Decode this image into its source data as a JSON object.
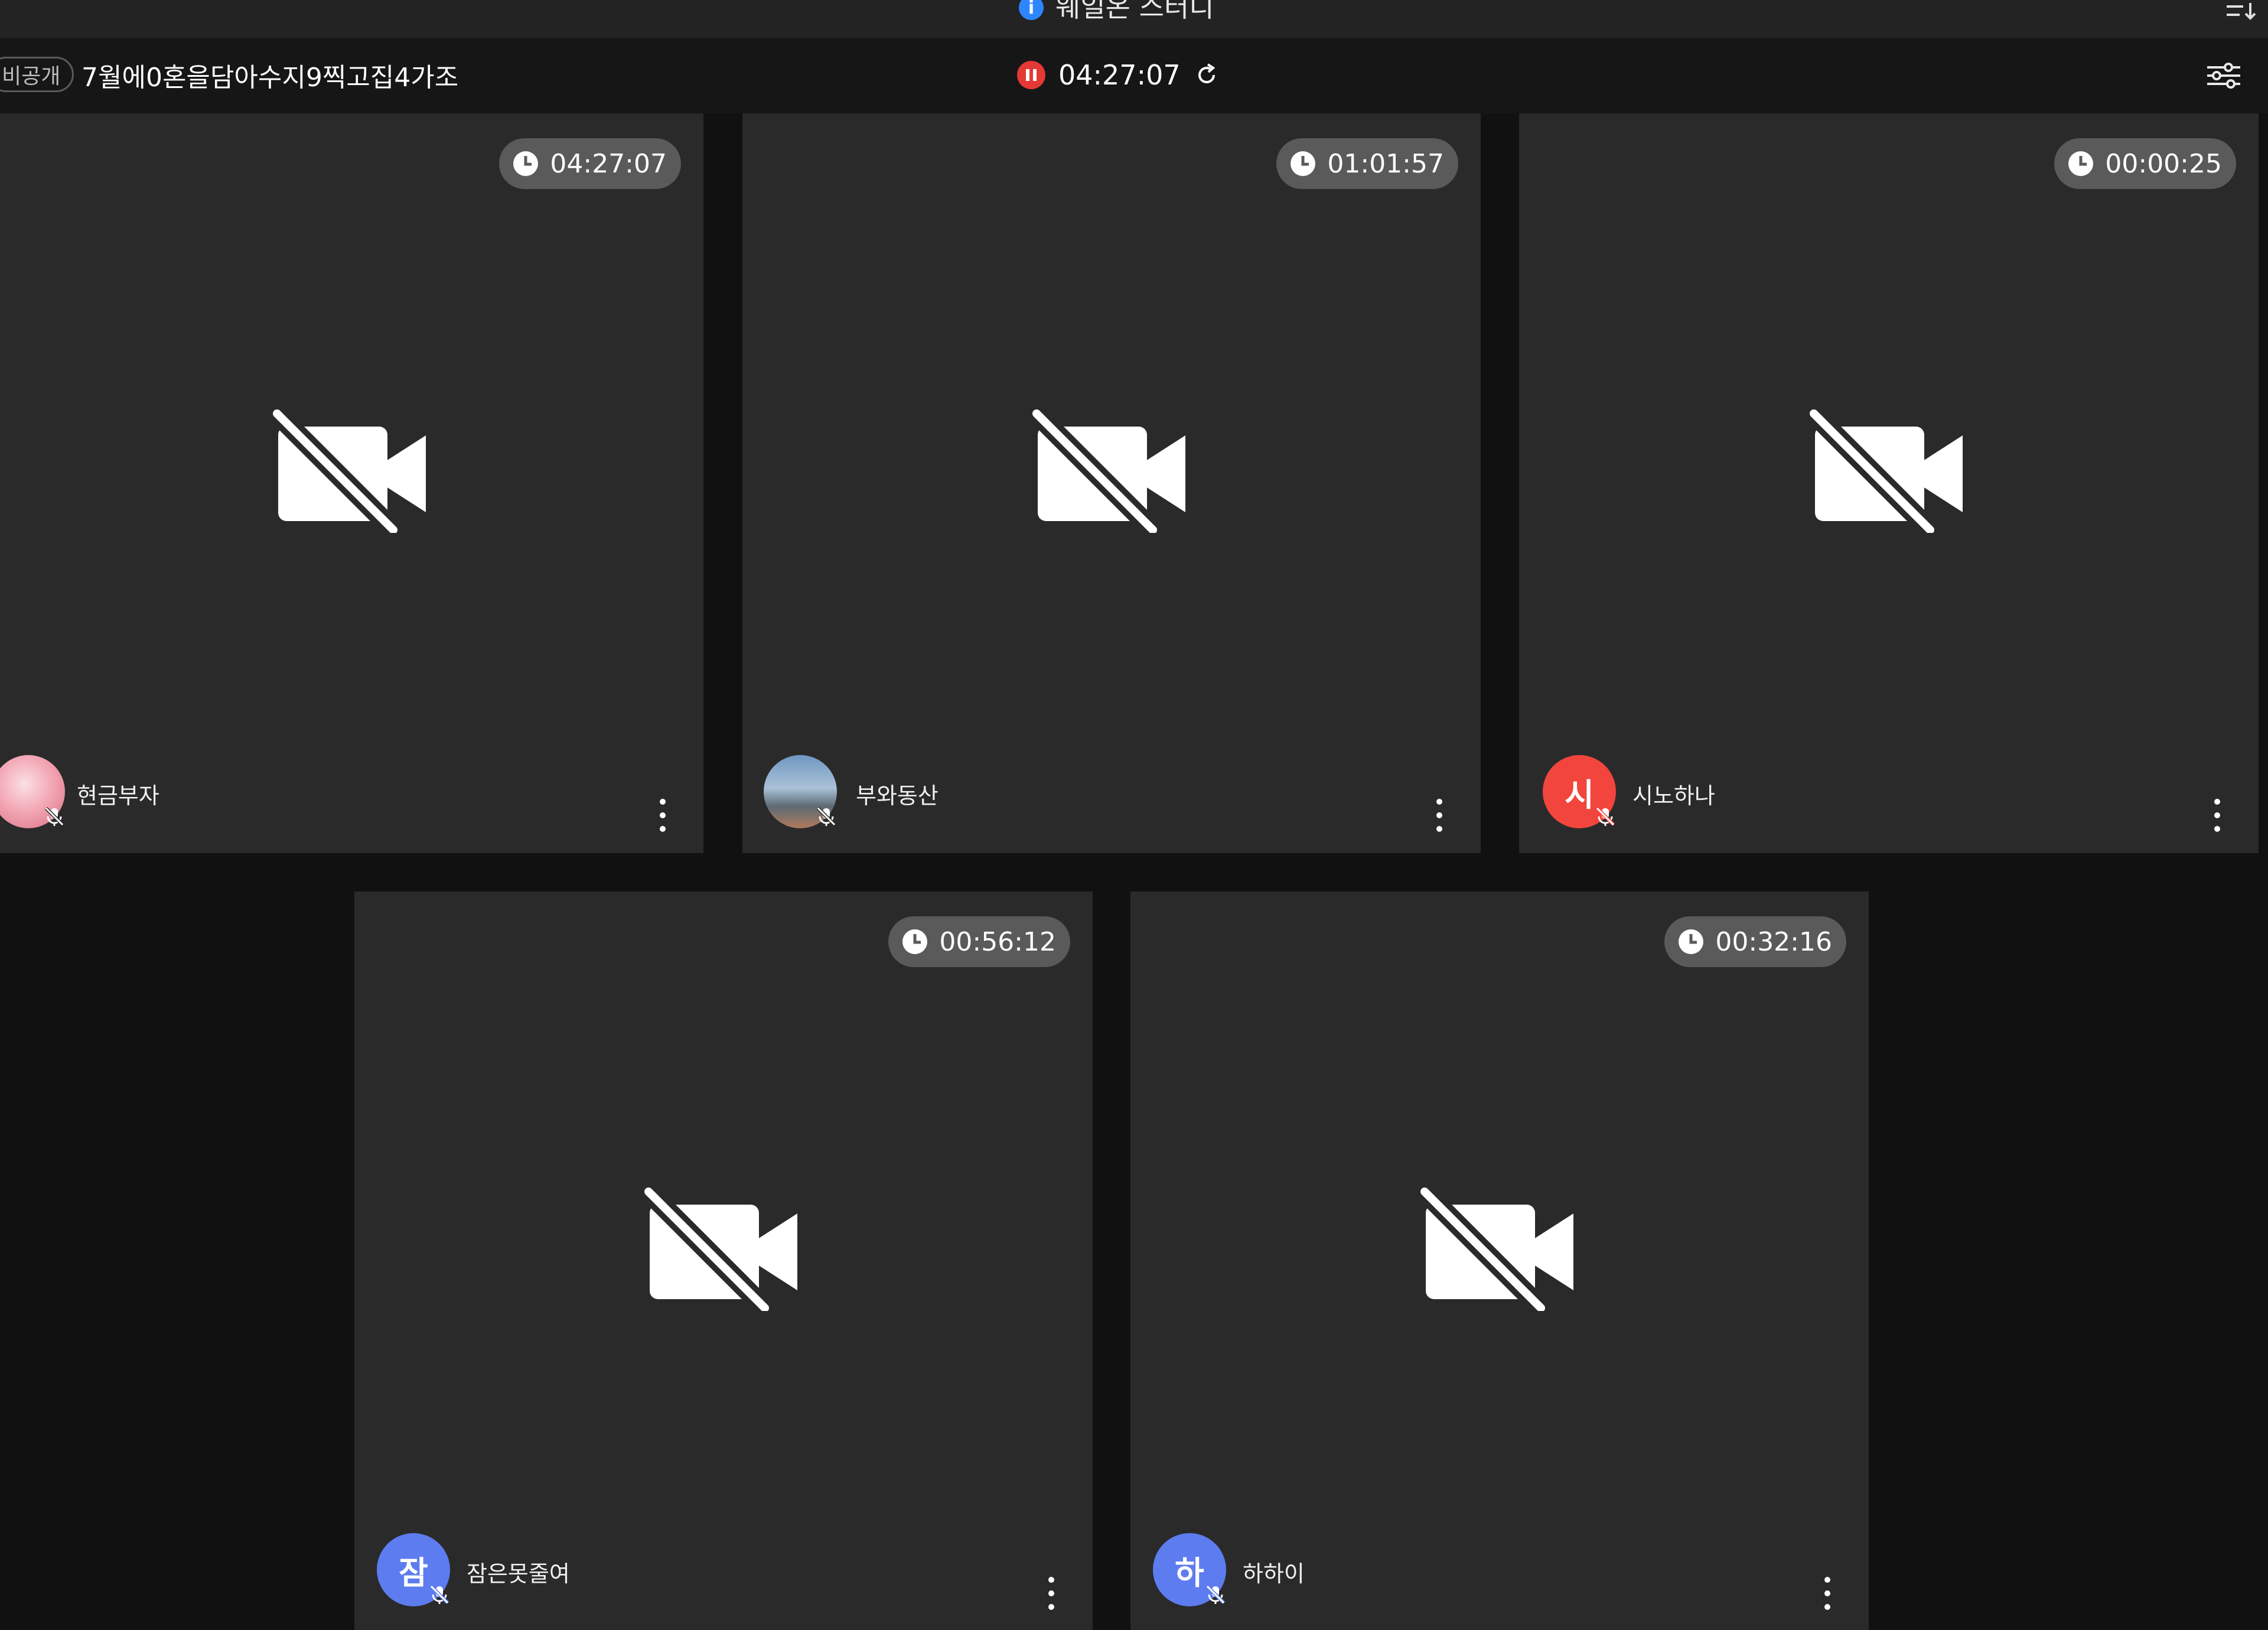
{
  "notice": {
    "text": "웨일온 스터디"
  },
  "header": {
    "privacy_badge": "비공개",
    "room_title": "7월에0혼을담아수지9찍고집4가조",
    "elapsed": "04:27:07"
  },
  "colors": {
    "tile_bg": "#2a2a2a",
    "page_bg": "#111111",
    "record_red": "#e53935",
    "avatar_blue": "#5d7cf0",
    "avatar_red": "#f2453d"
  },
  "participants": [
    {
      "name": "현금부자",
      "timer": "04:27:07",
      "avatar_type": "image",
      "avatar_icon": "pink-character-avatar",
      "muted": true,
      "camera_off": true
    },
    {
      "name": "부와동산",
      "timer": "01:01:57",
      "avatar_type": "image",
      "avatar_icon": "landscape-photo-avatar",
      "muted": true,
      "camera_off": true
    },
    {
      "name": "시노하나",
      "timer": "00:00:25",
      "avatar_type": "initial",
      "avatar_initial": "시",
      "muted": true,
      "camera_off": true
    },
    {
      "name": "잠은못줄여",
      "timer": "00:56:12",
      "avatar_type": "initial",
      "avatar_initial": "잠",
      "muted": true,
      "camera_off": true
    },
    {
      "name": "하하이",
      "timer": "00:32:16",
      "avatar_type": "initial",
      "avatar_initial": "하",
      "muted": true,
      "camera_off": true
    }
  ]
}
